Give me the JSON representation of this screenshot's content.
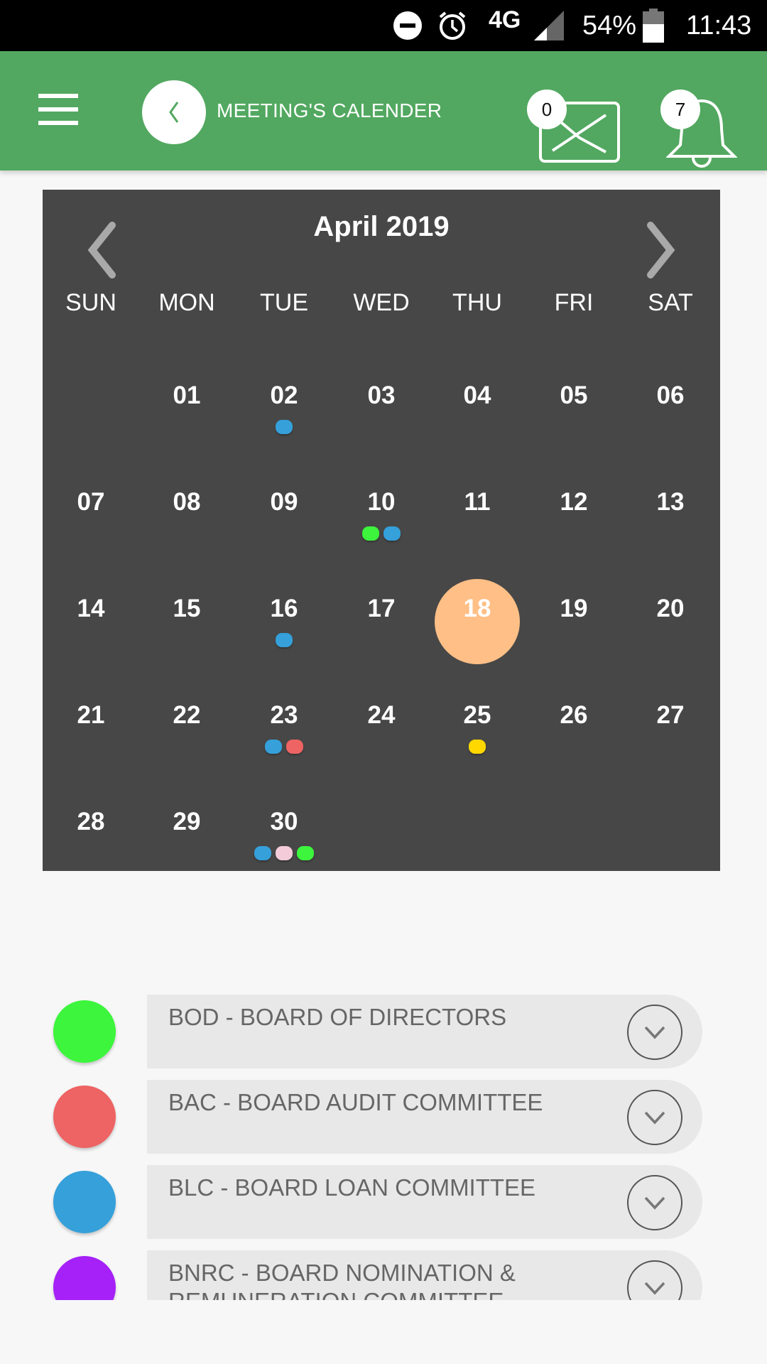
{
  "status_bar": {
    "network": "4G",
    "battery": "54%",
    "time": "11:43",
    "icons": [
      "do-not-disturb-icon",
      "alarm-icon",
      "signal-icon",
      "battery-icon"
    ]
  },
  "app_bar": {
    "title": "MEETING'S CALENDER",
    "mail_badge": "0",
    "notification_badge": "7",
    "colors": {
      "primary": "#52a860"
    }
  },
  "calendar": {
    "month_title": "April 2019",
    "weekdays": [
      "SUN",
      "MON",
      "TUE",
      "WED",
      "THU",
      "FRI",
      "SAT"
    ],
    "today": "18",
    "today_color": "#ffbf86",
    "weeks": [
      [
        null,
        {
          "d": "01"
        },
        {
          "d": "02",
          "dots": [
            "blc"
          ]
        },
        {
          "d": "03"
        },
        {
          "d": "04"
        },
        {
          "d": "05"
        },
        {
          "d": "06"
        }
      ],
      [
        {
          "d": "07"
        },
        {
          "d": "08"
        },
        {
          "d": "09"
        },
        {
          "d": "10",
          "dots": [
            "bod",
            "blc"
          ]
        },
        {
          "d": "11"
        },
        {
          "d": "12"
        },
        {
          "d": "13"
        }
      ],
      [
        {
          "d": "14"
        },
        {
          "d": "15"
        },
        {
          "d": "16",
          "dots": [
            "blc"
          ]
        },
        {
          "d": "17"
        },
        {
          "d": "18"
        },
        {
          "d": "19"
        },
        {
          "d": "20"
        }
      ],
      [
        {
          "d": "21"
        },
        {
          "d": "22"
        },
        {
          "d": "23",
          "dots": [
            "blc",
            "bac"
          ]
        },
        {
          "d": "24"
        },
        {
          "d": "25",
          "dots": [
            "yellow"
          ]
        },
        {
          "d": "26"
        },
        {
          "d": "27"
        }
      ],
      [
        {
          "d": "28"
        },
        {
          "d": "29"
        },
        {
          "d": "30",
          "dots": [
            "blc",
            "pink",
            "bod"
          ]
        },
        null,
        null,
        null,
        null
      ]
    ],
    "dot_colors": {
      "bod": "#3cf53c",
      "bac": "#ee6363",
      "blc": "#35a0da",
      "bnrc": "#a521f7",
      "yellow": "#ffd800",
      "pink": "#f3cbd9"
    }
  },
  "legend": [
    {
      "label": "BOD - BOARD OF DIRECTORS",
      "color": "#3cf53c"
    },
    {
      "label": "BAC - BOARD AUDIT COMMITTEE",
      "color": "#ee6363"
    },
    {
      "label": "BLC - BOARD LOAN COMMITTEE",
      "color": "#35a0da"
    },
    {
      "label": "BNRC - BOARD NOMINATION & REMUNERATION COMMITTEE",
      "color": "#a521f7"
    }
  ]
}
